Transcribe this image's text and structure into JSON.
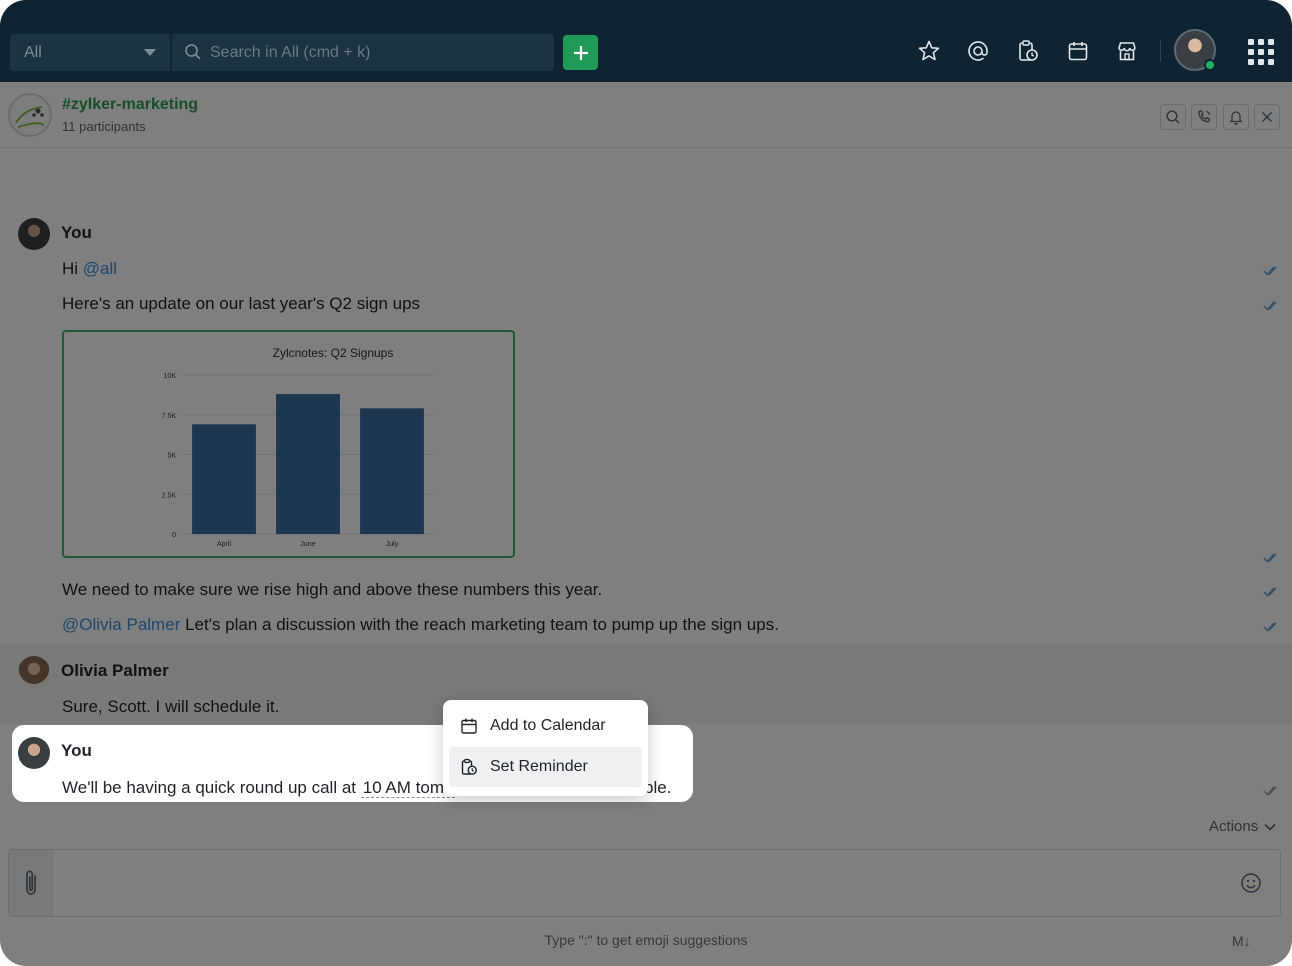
{
  "topbar": {
    "scope_label": "All",
    "search_placeholder": "Search in All (cmd + k)",
    "icons": [
      "star-icon",
      "mention-icon",
      "reminder-icon",
      "calendar-icon",
      "store-icon",
      "apps-grid-icon"
    ]
  },
  "channel": {
    "name": "#zylker-marketing",
    "participants": "11 participants",
    "actions": [
      "search-icon",
      "call-icon",
      "bell-icon",
      "close-icon"
    ]
  },
  "messages": [
    {
      "sender": "You",
      "lines": [
        {
          "prefix": "Hi ",
          "mention": "@all",
          "text": ""
        },
        {
          "text": "Here's an update on our last year's Q2 sign ups"
        },
        {
          "text": "We need to make sure we rise high and above these numbers this year."
        },
        {
          "mention": "@Olivia Palmer",
          "text": " Let's plan a discussion with the reach marketing team to pump up the sign ups."
        }
      ]
    },
    {
      "sender": "Olivia Palmer",
      "lines": [
        {
          "text": "Sure, Scott. I will schedule it."
        }
      ]
    },
    {
      "sender": "You",
      "lines": [
        {
          "prefix": "We'll be having a quick round up call at ",
          "time": "10 AM tomo",
          "suffix": "ble."
        }
      ]
    }
  ],
  "chart_data": {
    "type": "bar",
    "title": "Zylcnotes: Q2 Signups",
    "categories": [
      "April",
      "June",
      "July"
    ],
    "values": [
      6900,
      8800,
      7900
    ],
    "ylim": [
      0,
      10000
    ],
    "yticks": [
      0,
      2500,
      5000,
      7500,
      10000
    ],
    "ytick_labels": [
      "0",
      "2.5K",
      "5K",
      "7.5K",
      "10K"
    ],
    "bar_color": "#3b6fa1",
    "grid": true
  },
  "actions_label": "Actions",
  "context_menu": {
    "items": [
      {
        "label": "Add to Calendar",
        "icon": "calendar-icon"
      },
      {
        "label": "Set Reminder",
        "icon": "reminder-icon"
      }
    ]
  },
  "composer": {
    "hint": "Type \":\" to get emoji suggestions",
    "markdown_badge": "M↓"
  },
  "colors": {
    "topbar": "#0f2432",
    "accent_green": "#1f9b57",
    "mention_blue": "#3d8fd6",
    "channel_green": "#2f9b56"
  }
}
